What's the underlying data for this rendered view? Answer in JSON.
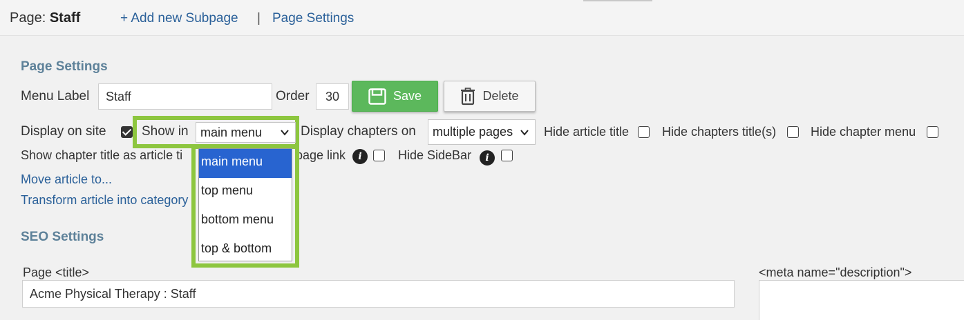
{
  "header": {
    "page_label": "Page:",
    "page_name": "Staff",
    "add_subpage": "+ Add new Subpage",
    "separator": "|",
    "page_settings_link": "Page Settings"
  },
  "page_settings": {
    "heading": "Page Settings",
    "menu_label_label": "Menu Label",
    "menu_label_value": "Staff",
    "order_label": "Order",
    "order_value": "30",
    "save_label": "Save",
    "delete_label": "Delete",
    "display_on_site_label": "Display on site",
    "display_on_site_checked": true,
    "show_in_label": "Show in",
    "show_in_value": "main menu",
    "show_in_options": [
      "main menu",
      "top menu",
      "bottom menu",
      "top & bottom"
    ],
    "show_in_selected_index": 0,
    "display_chapters_label": "Display chapters on",
    "display_chapters_value": "multiple pages",
    "hide_article_title_label": "Hide article title",
    "hide_chapters_title_label": "Hide chapters title(s)",
    "hide_chapter_menu_label": "Hide chapter menu",
    "show_chapter_title_label": "Show chapter title as article ti",
    "page_link_label": "page link",
    "hide_sidebar_label": "Hide SideBar",
    "move_article_link": "Move article to...",
    "transform_link": "Transform article into category"
  },
  "seo_settings": {
    "heading": "SEO Settings",
    "title_label": "Page <title>",
    "title_value": "Acme Physical Therapy : Staff",
    "meta_description_label": "<meta name=\"description\">"
  },
  "colors": {
    "highlight": "#8dc63f",
    "save_button": "#5cb85c",
    "link": "#2a6099",
    "section_heading": "#5d8199",
    "dropdown_selected": "#2864d0"
  }
}
